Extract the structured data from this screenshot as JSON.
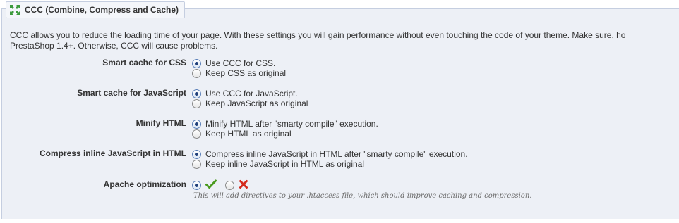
{
  "section": {
    "title": "CCC (Combine, Compress and Cache)",
    "icon": "arrows-compress-icon",
    "description_line1": "CCC allows you to reduce the loading time of your page. With these settings you will gain performance without even touching the code of your theme. Make sure, ho",
    "description_line2": "PrestaShop 1.4+. Otherwise, CCC will cause problems."
  },
  "settings": [
    {
      "label": "Smart cache for CSS",
      "options": [
        {
          "text": "Use CCC for CSS.",
          "checked": true
        },
        {
          "text": "Keep CSS as original",
          "checked": false
        }
      ]
    },
    {
      "label": "Smart cache for JavaScript",
      "options": [
        {
          "text": "Use CCC for JavaScript.",
          "checked": true
        },
        {
          "text": "Keep JavaScript as original",
          "checked": false
        }
      ]
    },
    {
      "label": "Minify HTML",
      "options": [
        {
          "text": "Minify HTML after \"smarty compile\" execution.",
          "checked": true
        },
        {
          "text": "Keep HTML as original",
          "checked": false
        }
      ]
    },
    {
      "label": "Compress inline JavaScript in HTML",
      "options": [
        {
          "text": "Compress inline JavaScript in HTML after \"smarty compile\" execution.",
          "checked": true
        },
        {
          "text": "Keep inline JavaScript in HTML as original",
          "checked": false
        }
      ]
    }
  ],
  "apache": {
    "label": "Apache optimization",
    "enabled": true,
    "yes_icon": "check-icon",
    "no_icon": "cross-icon",
    "hint": "This will add directives to your .htaccess file, which should improve caching and compression."
  },
  "colors": {
    "panel_bg": "#edf0f6",
    "panel_border": "#c5cee0",
    "check_green": "#4a9a1e",
    "cross_red": "#d42b1e"
  }
}
